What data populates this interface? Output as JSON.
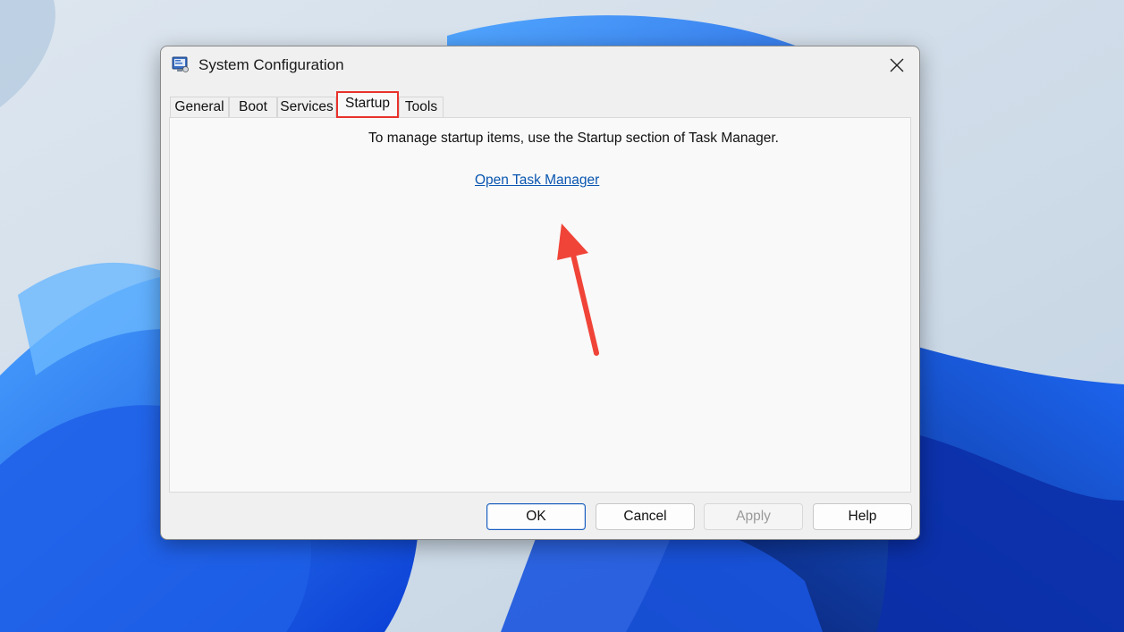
{
  "window": {
    "title": "System Configuration",
    "icon": "msconfig-icon",
    "close_icon": "close-icon"
  },
  "tabs": [
    {
      "label": "General"
    },
    {
      "label": "Boot"
    },
    {
      "label": "Services"
    },
    {
      "label": "Startup",
      "selected": true
    },
    {
      "label": "Tools"
    }
  ],
  "startup_panel": {
    "message": "To manage startup items, use the Startup section of Task Manager.",
    "link_label": "Open Task Manager"
  },
  "buttons": {
    "ok": "OK",
    "cancel": "Cancel",
    "apply": "Apply",
    "apply_disabled": true,
    "help": "Help"
  },
  "annotation": {
    "highlight_color": "#e8322b",
    "arrow_color": "#f04438",
    "arrow_target": "Open Task Manager"
  }
}
